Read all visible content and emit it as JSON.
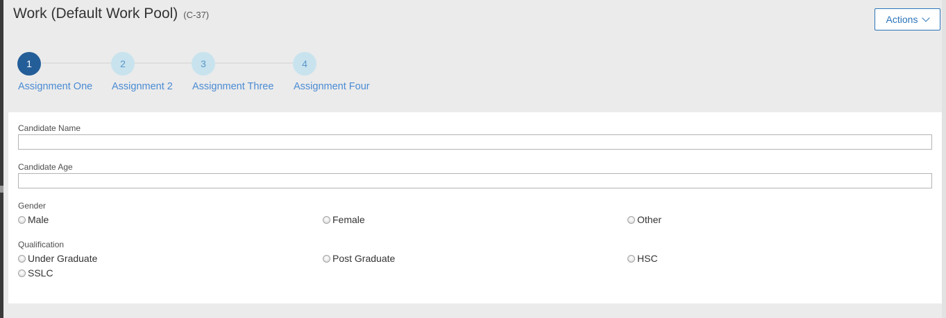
{
  "header": {
    "title": "Work (Default Work Pool)",
    "case_id": "(C-37)",
    "actions_label": "Actions"
  },
  "stepper": {
    "steps": [
      {
        "number": "1",
        "label": "Assignment One",
        "active": true
      },
      {
        "number": "2",
        "label": "Assignment 2",
        "active": false
      },
      {
        "number": "3",
        "label": "Assignment Three",
        "active": false
      },
      {
        "number": "4",
        "label": "Assignment Four",
        "active": false
      }
    ]
  },
  "form": {
    "candidate_name": {
      "label": "Candidate Name",
      "value": "",
      "placeholder": ""
    },
    "candidate_age": {
      "label": "Candidate Age",
      "value": "",
      "placeholder": ""
    },
    "gender": {
      "label": "Gender",
      "options": [
        "Male",
        "Female",
        "Other"
      ],
      "selected": null
    },
    "qualification": {
      "label": "Qualification",
      "options": [
        "Under Graduate",
        "Post Graduate",
        "HSC",
        "SSLC"
      ],
      "selected": null
    }
  },
  "colors": {
    "accent": "#2a73b8",
    "step_active": "#245e99",
    "step_inactive": "#c8e3ee",
    "step_label": "#4a8bd4",
    "background": "#ebebeb"
  },
  "icons": {
    "actions": "chevron-down-icon",
    "radio": "radio-unchecked-icon"
  }
}
